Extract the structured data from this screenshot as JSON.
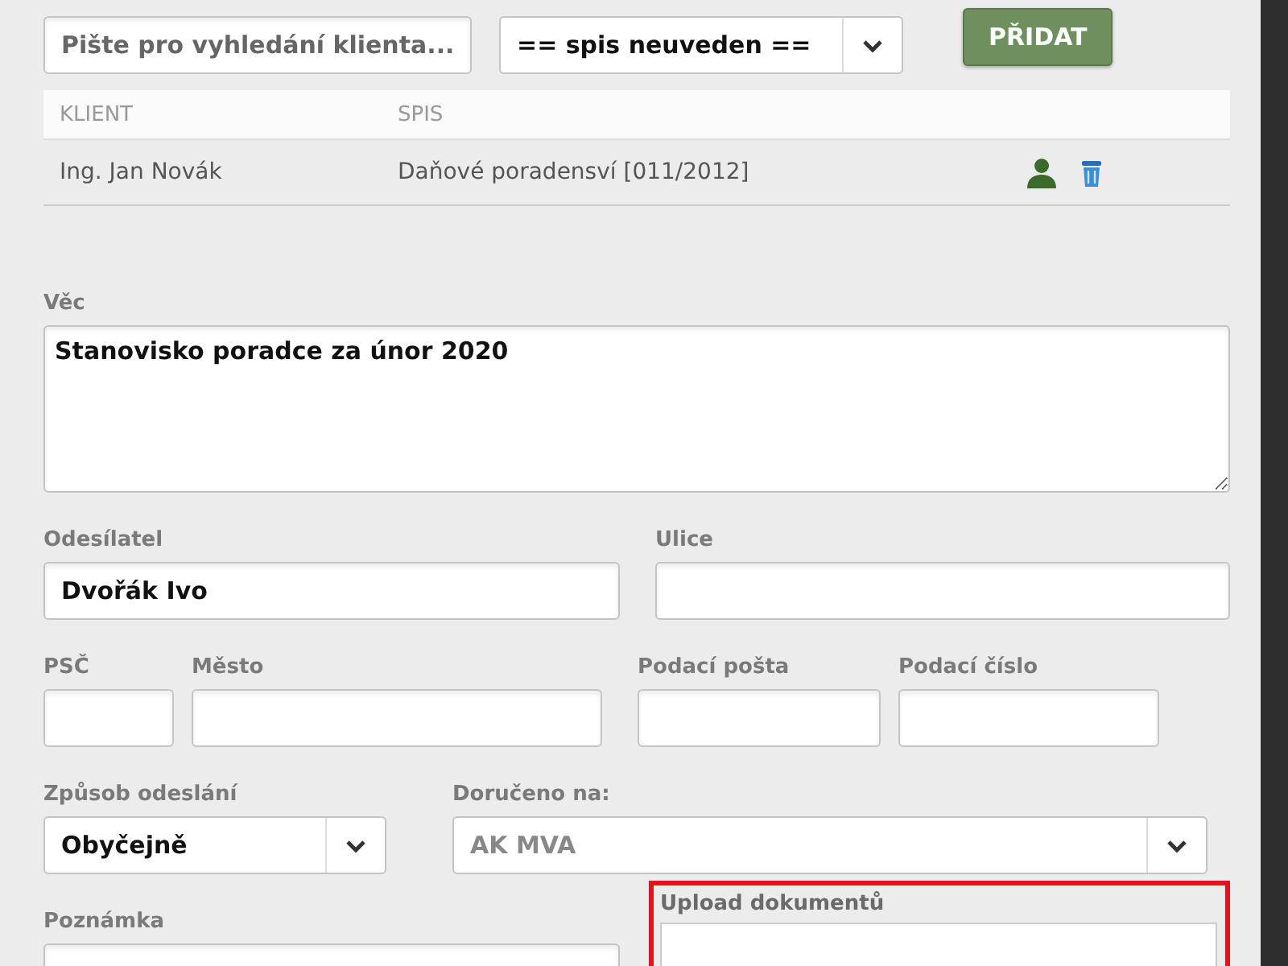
{
  "search": {
    "placeholder": "Pište pro vyhledání klienta..."
  },
  "file_select": {
    "value": "== spis neuveden =="
  },
  "add_button": "PŘIDAT",
  "table": {
    "columns": [
      "KLIENT",
      "SPIS"
    ],
    "rows": [
      {
        "cells": [
          "Ing. Jan Novák",
          "Daňové poradensví [011/2012]"
        ]
      }
    ]
  },
  "rows": [
    {
      "fields": [
        {
          "kind": "textarea",
          "label": "Věc",
          "value": "Stanovisko poradce za únor 2020"
        }
      ]
    },
    {
      "fields": [
        {
          "kind": "text",
          "label": "Odesílatel",
          "value": "Dvořák Ivo"
        },
        {
          "kind": "text",
          "label": "Ulice"
        }
      ]
    },
    {
      "fields": [
        {
          "kind": "text",
          "label": "PSČ"
        },
        {
          "kind": "text",
          "label": "Město"
        },
        {
          "kind": "text",
          "label": "Podací pošta"
        },
        {
          "kind": "text",
          "label": "Podací číslo"
        }
      ]
    },
    {
      "fields": [
        {
          "kind": "select",
          "label": "Způsob odeslání",
          "value": "Obyčejně",
          "disabled": false
        },
        {
          "kind": "select",
          "label": "Doručeno na:",
          "value": "AK MVA",
          "disabled": true
        }
      ]
    },
    {
      "fields": [
        {
          "kind": "text",
          "label": "Poznámka"
        },
        {
          "kind": "upload",
          "label": "Upload dokumentů",
          "highlighted": true
        }
      ]
    }
  ]
}
